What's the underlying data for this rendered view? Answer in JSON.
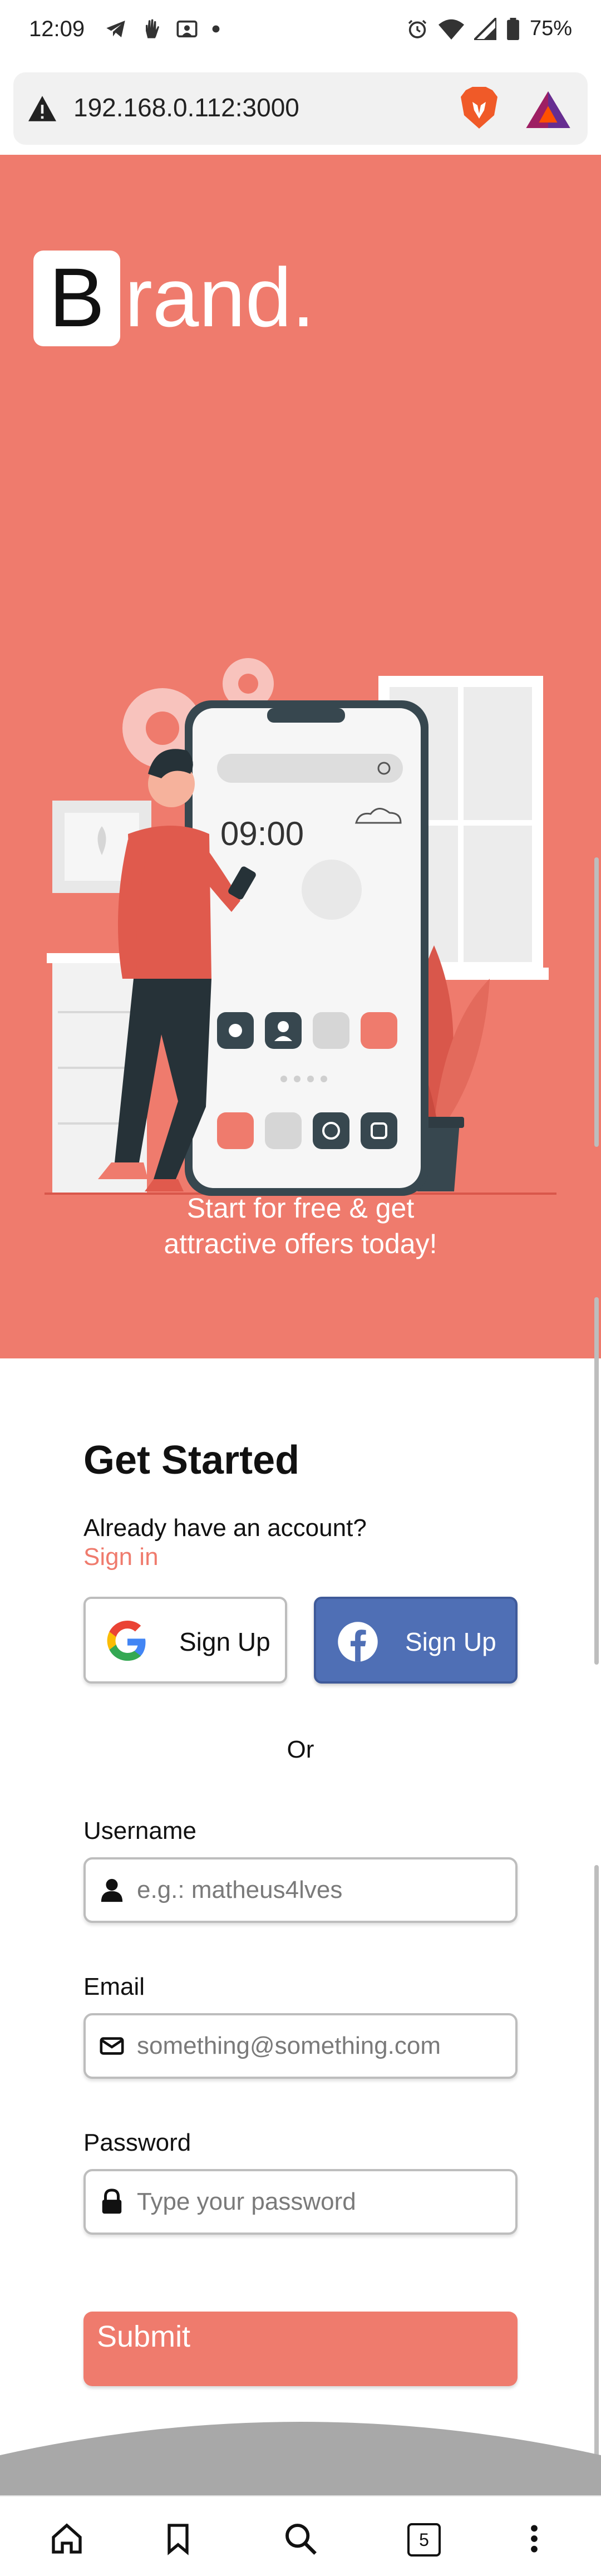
{
  "status_bar": {
    "time": "12:09",
    "battery": "75%",
    "left_icons": [
      "telegram-icon",
      "hand-icon",
      "cast-icon",
      "dot-icon"
    ],
    "right_icons": [
      "alarm-icon",
      "wifi-icon",
      "signal-icon",
      "battery-icon"
    ]
  },
  "browser": {
    "url": "192.168.0.112:3000",
    "security_icon": "warning-icon",
    "extension_icons": [
      "brave-lion-icon",
      "bat-rewards-icon"
    ]
  },
  "hero": {
    "brand_letter": "B",
    "brand_rest": "rand.",
    "tagline_line1": "Start for free & get",
    "tagline_line2": "attractive offers today!",
    "background_color": "#ef7b6d",
    "illustration": {
      "phone_time": "09:00"
    }
  },
  "form": {
    "title": "Get Started",
    "already_text": "Already have an account?",
    "signin_link": "Sign in",
    "google_button": "Sign Up",
    "facebook_button": "Sign Up",
    "or_text": "Or",
    "username_label": "Username",
    "username_placeholder": "e.g.: matheus4lves",
    "email_label": "Email",
    "email_placeholder": "something@something.com",
    "password_label": "Password",
    "password_placeholder": "Type your password",
    "submit_label": "Submit",
    "accent_color": "#ef7b6d",
    "facebook_color": "#4f6fb5"
  },
  "bottom_nav": {
    "tab_count": "5",
    "items": [
      "home-icon",
      "bookmark-icon",
      "search-icon",
      "tabs-icon",
      "more-icon"
    ]
  }
}
